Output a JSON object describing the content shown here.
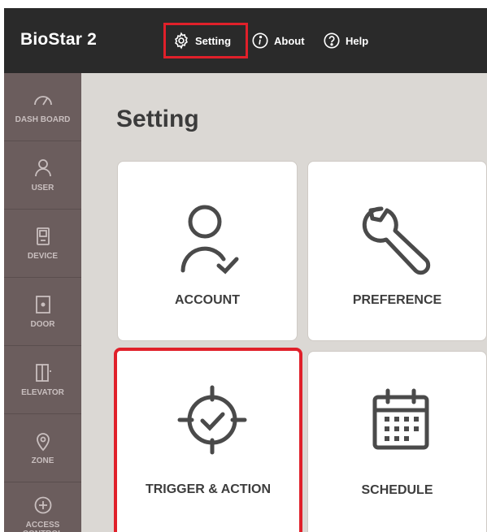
{
  "header": {
    "brand": "BioStar 2",
    "nav": [
      {
        "label": "Setting",
        "icon": "gear-icon"
      },
      {
        "label": "About",
        "icon": "info-icon"
      },
      {
        "label": "Help",
        "icon": "help-icon"
      }
    ]
  },
  "sidebar": {
    "items": [
      {
        "label": "DASH BOARD",
        "icon": "dashboard-icon"
      },
      {
        "label": "USER",
        "icon": "user-icon"
      },
      {
        "label": "DEVICE",
        "icon": "device-icon"
      },
      {
        "label": "DOOR",
        "icon": "door-icon"
      },
      {
        "label": "ELEVATOR",
        "icon": "elevator-icon"
      },
      {
        "label": "ZONE",
        "icon": "zone-icon"
      },
      {
        "label": "ACCESS CONTROL",
        "icon": "access-control-icon"
      }
    ]
  },
  "main": {
    "title": "Setting",
    "cards": [
      {
        "label": "ACCOUNT",
        "icon": "account-icon"
      },
      {
        "label": "PREFERENCE",
        "icon": "wrench-icon"
      },
      {
        "label": "TRIGGER & ACTION",
        "icon": "target-check-icon"
      },
      {
        "label": "SCHEDULE",
        "icon": "calendar-icon"
      }
    ]
  },
  "colors": {
    "topbar": "#2a2a2a",
    "sidebar": "#6b5d5d",
    "sidebar_text": "#c9bfbf",
    "background": "#dbd8d4",
    "highlight": "#e0202a",
    "card_text": "#3d3d3d"
  }
}
